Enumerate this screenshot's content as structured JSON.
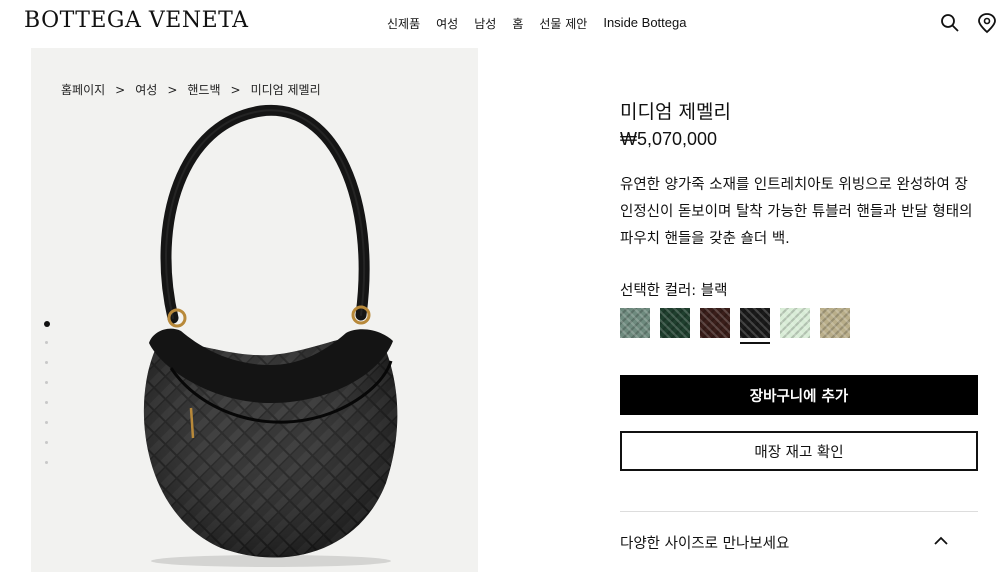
{
  "brand": {
    "logo": "BOTTEGA VENETA"
  },
  "nav": {
    "items": [
      {
        "label": "신제품"
      },
      {
        "label": "여성"
      },
      {
        "label": "남성"
      },
      {
        "label": "홈"
      },
      {
        "label": "선물 제안"
      },
      {
        "label": "Inside Bottega"
      }
    ]
  },
  "header_icons": [
    "search-icon",
    "location-icon"
  ],
  "breadcrumb": {
    "items": [
      "홈페이지",
      "여성",
      "핸드백",
      "미디엄 제멜리"
    ],
    "separator": ">"
  },
  "gallery": {
    "image": "black woven leather half-moon shoulder bag",
    "current_index": 1,
    "total": 8
  },
  "product": {
    "name": "미디엄 제멜리",
    "price": "₩5,070,000",
    "description": "유연한 양가죽 소재를 인트레치아토 위빙으로 완성하여 장인정신이 돋보이며 탈착 가능한 튜블러 핸들과 반달 형태의 파우치 핸들을 갖춘 숄더 백."
  },
  "color": {
    "label": "선택한 컬러: 블랙",
    "swatches": [
      {
        "color": "#6e8a7e"
      },
      {
        "color": "#1f3f2e"
      },
      {
        "color": "#3a1e1a"
      },
      {
        "color": "#1a1a1a",
        "selected": true
      },
      {
        "color": "#d8ecd6"
      },
      {
        "color": "#b9ae8a"
      }
    ]
  },
  "actions": {
    "add_to_cart": "장바구니에 추가",
    "check_stock": "매장 재고 확인"
  },
  "accordion": {
    "label": "다양한 사이즈로 만나보세요",
    "icon": "chevron-up-icon",
    "expanded": true
  }
}
